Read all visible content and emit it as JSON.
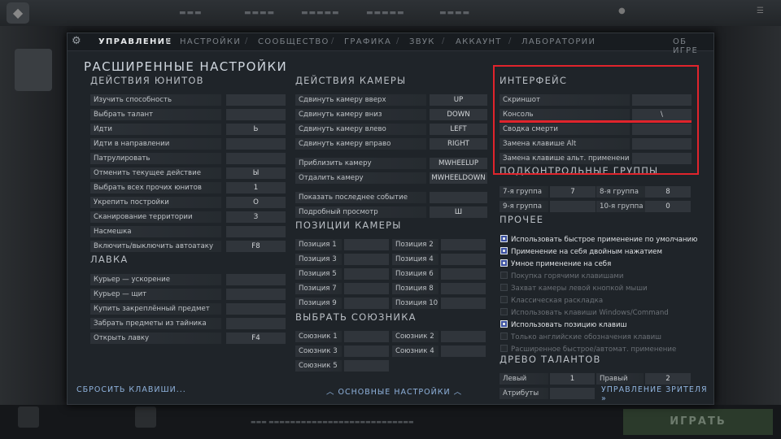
{
  "topbar": {
    "tabs": [
      "УПРАВЛЕНИЕ",
      "НАСТРОЙКИ",
      "СООБЩЕСТВО",
      "ГРАФИКА",
      "ЗВУК",
      "АККАУНТ",
      "ЛАБОРАТОРИИ"
    ],
    "about": "ОБ ИГРЕ"
  },
  "title": "РАСШИРЕННЫЕ НАСТРОЙКИ",
  "units": {
    "heading": "ДЕЙСТВИЯ ЮНИТОВ",
    "rows": [
      {
        "label": "Изучить способность",
        "key": ""
      },
      {
        "label": "Выбрать талант",
        "key": ""
      },
      {
        "label": "Идти",
        "key": "Ь"
      },
      {
        "label": "Идти в направлении",
        "key": ""
      },
      {
        "label": "Патрулировать",
        "key": ""
      },
      {
        "label": "Отменить текущее действие",
        "key": "Ы"
      },
      {
        "label": "Выбрать всех прочих юнитов",
        "key": "1"
      },
      {
        "label": "Укрепить постройки",
        "key": "О"
      },
      {
        "label": "Сканирование территории",
        "key": "З"
      },
      {
        "label": "Насмешка",
        "key": ""
      },
      {
        "label": "Включить/выключить автоатаку",
        "key": "F8"
      }
    ]
  },
  "shop": {
    "heading": "ЛАВКА",
    "rows": [
      {
        "label": "Курьер — ускорение",
        "key": ""
      },
      {
        "label": "Курьер — щит",
        "key": ""
      },
      {
        "label": "Купить закреплённый предмет",
        "key": ""
      },
      {
        "label": "Забрать предметы из тайника",
        "key": ""
      },
      {
        "label": "Открыть лавку",
        "key": "F4"
      }
    ]
  },
  "camera": {
    "heading": "ДЕЙСТВИЯ КАМЕРЫ",
    "rows": [
      {
        "label": "Сдвинуть камеру вверх",
        "key": "UP"
      },
      {
        "label": "Сдвинуть камеру вниз",
        "key": "DOWN"
      },
      {
        "label": "Сдвинуть камеру влево",
        "key": "LEFT"
      },
      {
        "label": "Сдвинуть камеру вправо",
        "key": "RIGHT"
      },
      {
        "label": "Приблизить камеру",
        "key": "MWHEELUP"
      },
      {
        "label": "Отдалить камеру",
        "key": "MWHEELDOWN"
      },
      {
        "label": "Показать последнее событие",
        "key": ""
      },
      {
        "label": "Подробный просмотр",
        "key": "Ш"
      }
    ]
  },
  "camera_positions": {
    "heading": "ПОЗИЦИИ КАМЕРЫ",
    "left": [
      "Позиция 1",
      "Позиция 3",
      "Позиция 5",
      "Позиция 7",
      "Позиция 9"
    ],
    "right": [
      "Позиция 2",
      "Позиция 4",
      "Позиция 6",
      "Позиция 8",
      "Позиция 10"
    ]
  },
  "allies": {
    "heading": "ВЫБРАТЬ СОЮЗНИКА",
    "left": [
      "Союзник 1",
      "Союзник 3",
      "Союзник 5"
    ],
    "right": [
      "Союзник 2",
      "Союзник 4"
    ]
  },
  "interface": {
    "heading": "ИНТЕРФЕЙС",
    "rows": [
      {
        "label": "Скриншот",
        "key": ""
      },
      {
        "label": "Консоль",
        "key": "\\"
      },
      {
        "label": "Сводка смерти",
        "key": ""
      },
      {
        "label": "Замена клавише Alt",
        "key": ""
      },
      {
        "label": "Замена клавише альт. применения",
        "key": ""
      }
    ]
  },
  "groups": {
    "heading": "ПОДКОНТРОЛЬНЫЕ ГРУППЫ",
    "items": [
      {
        "label": "7-я группа",
        "key": "7"
      },
      {
        "label": "8-я группа",
        "key": "8"
      },
      {
        "label": "9-я группа",
        "key": ""
      },
      {
        "label": "10-я группа",
        "key": "0"
      }
    ]
  },
  "other": {
    "heading": "ПРОЧЕЕ",
    "options": [
      {
        "label": "Использовать быстрое применение по умолчанию",
        "on": true
      },
      {
        "label": "Применение на себя двойным нажатием",
        "on": true
      },
      {
        "label": "Умное применение на себя",
        "on": true
      },
      {
        "label": "Покупка горячими клавишами",
        "on": false
      },
      {
        "label": "Захват камеры левой кнопкой мыши",
        "on": false
      },
      {
        "label": "Классическая раскладка",
        "on": false
      },
      {
        "label": "Использовать клавиши Windows/Command",
        "on": false
      },
      {
        "label": "Использовать позицию клавиш",
        "on": true
      },
      {
        "label": "Только английские обозначения клавиш",
        "on": false
      },
      {
        "label": "Расширенное быстрое/автомат. применение",
        "on": false
      }
    ]
  },
  "talents": {
    "heading": "ДРЕВО ТАЛАНТОВ",
    "left_label": "Левый",
    "left_key": "1",
    "right_label": "Правый",
    "right_key": "2",
    "attrs_label": "Атрибуты"
  },
  "footer": {
    "reset": "СБРОСИТЬ КЛАВИШИ...",
    "basic": "ОСНОВНЫЕ НАСТРОЙКИ",
    "viewer": "УПРАВЛЕНИЕ ЗРИТЕЛЯ"
  },
  "background": {
    "play": "ИГРАТЬ"
  },
  "colors": {
    "highlight": "#e0242c",
    "link": "#8fb2dc",
    "panel": "#1f2429"
  }
}
